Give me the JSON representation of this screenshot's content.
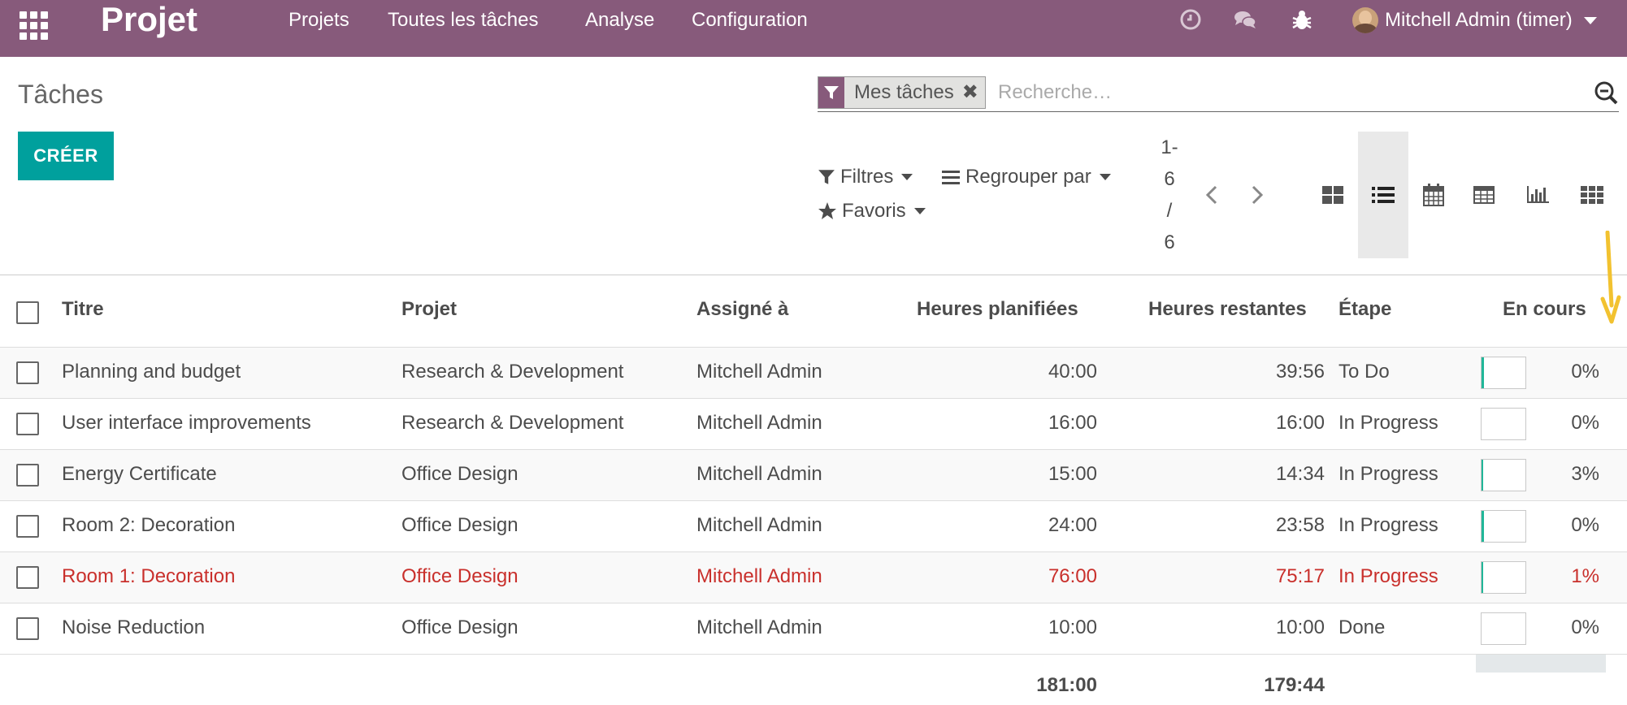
{
  "navbar": {
    "brand": "Projet",
    "menu": [
      "Projets",
      "Toutes les tâches",
      "Analyse",
      "Configuration"
    ],
    "user": "Mitchell Admin (timer)",
    "icons": [
      "clock-icon",
      "chat-icon",
      "bug-icon"
    ]
  },
  "page": {
    "title": "Tâches",
    "create_label": "CRÉER"
  },
  "search": {
    "facet": "Mes tâches",
    "facet_remove": "✖",
    "placeholder": "Recherche…"
  },
  "filters": {
    "filters_label": "Filtres",
    "groupby_label": "Regrouper par",
    "favorites_label": "Favoris"
  },
  "pager": {
    "lines": [
      "1-",
      "6",
      "/",
      "6"
    ]
  },
  "views": [
    "kanban",
    "list",
    "calendar",
    "pivot",
    "graph",
    "activity"
  ],
  "active_view": "list",
  "table": {
    "columns": [
      "Titre",
      "Projet",
      "Assigné à",
      "Heures planifiées",
      "Heures restantes",
      "Étape",
      "En cours"
    ],
    "rows": [
      {
        "title": "Planning and budget",
        "project": "Research & Development",
        "assignee": "Mitchell Admin",
        "planned": "40:00",
        "remaining": "39:56",
        "stage": "To Do",
        "progress": 0,
        "progress_label": "0%",
        "danger": false
      },
      {
        "title": "User interface improvements",
        "project": "Research & Development",
        "assignee": "Mitchell Admin",
        "planned": "16:00",
        "remaining": "16:00",
        "stage": "In Progress",
        "progress": 0,
        "progress_label": "0%",
        "danger": false
      },
      {
        "title": "Energy Certificate",
        "project": "Office Design",
        "assignee": "Mitchell Admin",
        "planned": "15:00",
        "remaining": "14:34",
        "stage": "In Progress",
        "progress": 3,
        "progress_label": "3%",
        "danger": false
      },
      {
        "title": "Room 2: Decoration",
        "project": "Office Design",
        "assignee": "Mitchell Admin",
        "planned": "24:00",
        "remaining": "23:58",
        "stage": "In Progress",
        "progress": 0,
        "progress_label": "0%",
        "danger": false
      },
      {
        "title": "Room 1: Decoration",
        "project": "Office Design",
        "assignee": "Mitchell Admin",
        "planned": "76:00",
        "remaining": "75:17",
        "stage": "In Progress",
        "progress": 1,
        "progress_label": "1%",
        "danger": true
      },
      {
        "title": "Noise Reduction",
        "project": "Office Design",
        "assignee": "Mitchell Admin",
        "planned": "10:00",
        "remaining": "10:00",
        "stage": "Done",
        "progress": 0,
        "progress_label": "0%",
        "danger": false
      }
    ],
    "totals": {
      "planned": "181:00",
      "remaining": "179:44"
    }
  },
  "colors": {
    "navbar": "#875a7b",
    "primary_button": "#00a09d",
    "danger_text": "#c9302c",
    "annotation_arrow": "#f2c230"
  }
}
